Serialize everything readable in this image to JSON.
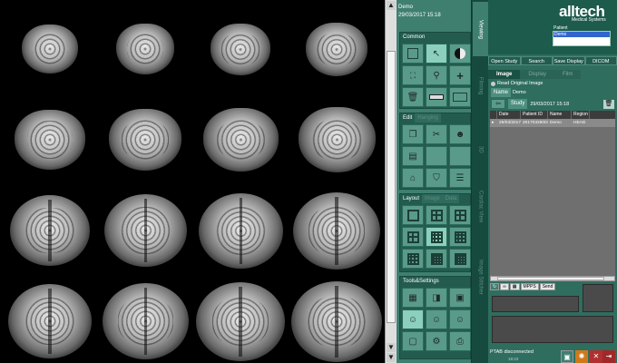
{
  "patient_info": {
    "name": "Demo",
    "datetime": "29/03/2017 15:18"
  },
  "tools": {
    "common": {
      "title": "Common"
    },
    "edit": {
      "title": "Edit",
      "tab2": "Hanging"
    },
    "layout": {
      "title": "Layout",
      "tab2": "Image",
      "tab3": "Data"
    },
    "tools_settings": {
      "title": "Tools&Settings"
    }
  },
  "side_tabs": [
    "Viewing",
    "Filming",
    "3D",
    "Cardiac View",
    "Image Stitcher"
  ],
  "brand": {
    "name": "alltech",
    "sub": "Medical Systems"
  },
  "patient_list": {
    "label": "Patient",
    "selected": "Demo"
  },
  "top_buttons": [
    "Open Study",
    "Search",
    "Save Display",
    "DICOM"
  ],
  "image_tabs": [
    "Image",
    "Display",
    "Film"
  ],
  "read_original": "Read Original Image",
  "name_row": {
    "label": "Name",
    "value": "Demo"
  },
  "study_row": {
    "label": "Study",
    "date": "29/03/2017  15:18"
  },
  "study_table": {
    "columns": [
      "",
      "Date",
      "Patient ID",
      "Name",
      "Region"
    ],
    "rows": [
      [
        "▸",
        "29/03/2017",
        "20170329001",
        "Demo",
        "HEAD"
      ]
    ]
  },
  "bottom_tools": [
    "MPPS",
    "Send"
  ],
  "status": {
    "text": "PTAB disconnected",
    "sub": "18:23"
  }
}
